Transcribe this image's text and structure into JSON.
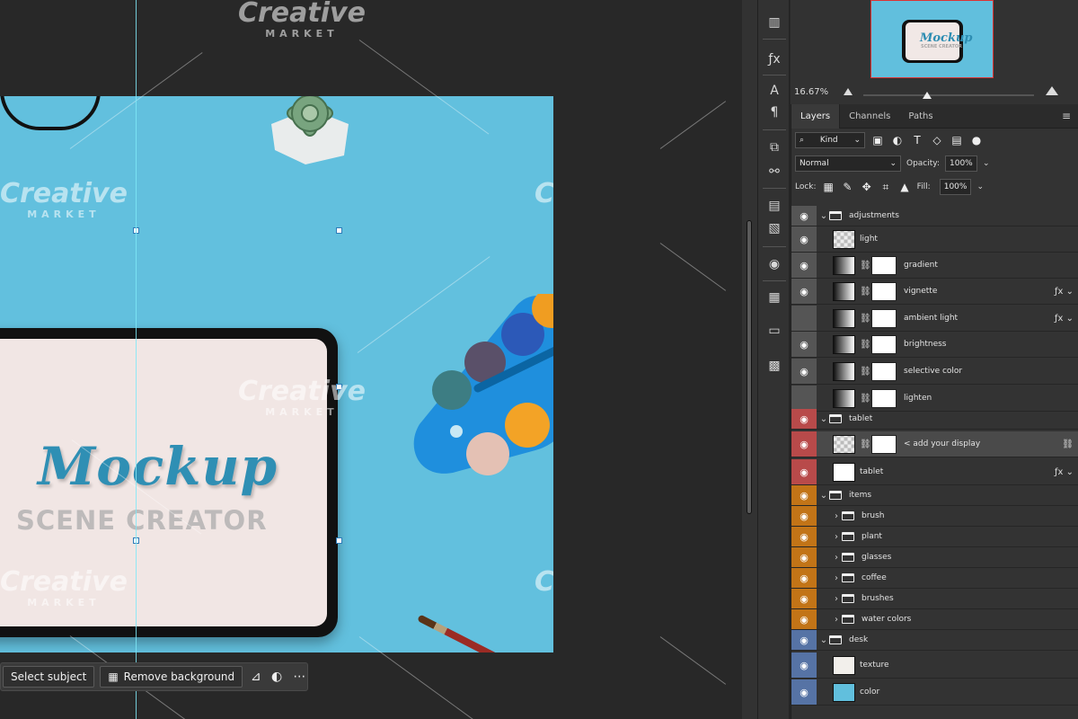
{
  "canvas": {
    "title": "Mockup",
    "subtitle": "SCENE CREATOR",
    "watermark": {
      "brand": "Creative",
      "market": "MARKET"
    }
  },
  "toolbar": {
    "select_subject": "Select subject",
    "remove_background": "Remove background"
  },
  "navigator": {
    "zoom": "16.67%"
  },
  "layers_panel": {
    "tabs": [
      "Layers",
      "Channels",
      "Paths"
    ],
    "filter_label": "Kind",
    "blend_mode": "Normal",
    "opacity_label": "Opacity:",
    "opacity_value": "100%",
    "lock_label": "Lock:",
    "fill_label": "Fill:",
    "fill_value": "100%",
    "layers": [
      {
        "name": "adjustments",
        "type": "group",
        "color": "#555555",
        "visible": true
      },
      {
        "name": "light",
        "type": "layer",
        "color": "#555555",
        "visible": true
      },
      {
        "name": "gradient",
        "type": "adjustment",
        "color": "#555555",
        "visible": true
      },
      {
        "name": "vignette",
        "type": "adjustment",
        "color": "#555555",
        "visible": true
      },
      {
        "name": "ambient light",
        "type": "adjustment",
        "color": "#555555",
        "visible": false
      },
      {
        "name": "brightness",
        "type": "adjustment",
        "color": "#555555",
        "visible": true
      },
      {
        "name": "selective color",
        "type": "adjustment",
        "color": "#555555",
        "visible": true
      },
      {
        "name": "lighten",
        "type": "adjustment",
        "color": "#555555",
        "visible": false
      },
      {
        "name": "tablet",
        "type": "group",
        "color": "#b84a4a",
        "visible": true
      },
      {
        "name": "< add your display",
        "type": "smart",
        "color": "#b84a4a",
        "visible": true
      },
      {
        "name": "tablet",
        "type": "layer",
        "color": "#b84a4a",
        "visible": true
      },
      {
        "name": "items",
        "type": "group",
        "color": "#c27417",
        "visible": true
      },
      {
        "name": "brush",
        "type": "subgroup",
        "color": "#c27417",
        "visible": true
      },
      {
        "name": "plant",
        "type": "subgroup",
        "color": "#c27417",
        "visible": true
      },
      {
        "name": "glasses",
        "type": "subgroup",
        "color": "#c27417",
        "visible": true
      },
      {
        "name": "coffee",
        "type": "subgroup",
        "color": "#c27417",
        "visible": true
      },
      {
        "name": "brushes",
        "type": "subgroup",
        "color": "#c27417",
        "visible": true
      },
      {
        "name": "water colors",
        "type": "subgroup",
        "color": "#c27417",
        "visible": true
      },
      {
        "name": "desk",
        "type": "group",
        "color": "#5673a5",
        "visible": true
      },
      {
        "name": "texture",
        "type": "layer",
        "color": "#5673a5",
        "visible": true
      },
      {
        "name": "color",
        "type": "layer",
        "color": "#5673a5",
        "visible": true
      }
    ]
  }
}
